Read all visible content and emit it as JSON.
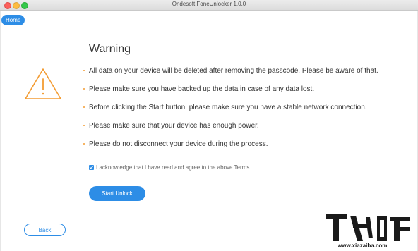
{
  "window": {
    "title": "Ondesoft FoneUnlocker 1.0.0"
  },
  "nav": {
    "home_label": "Home",
    "back_label": "Back"
  },
  "warning": {
    "title": "Warning",
    "items": [
      "All data on your device will be deleted after removing the passcode. Please be aware of that.",
      "Please make sure you have backed up the data in case of any data lost.",
      "Before clicking the Start button, please make sure you have a stable network connection.",
      "Please make sure that your device has enough power.",
      "Please do not disconnect your device during the process."
    ]
  },
  "acknowledge": {
    "checked": true,
    "label": "I acknowledge that I have read and agree to the above Terms."
  },
  "actions": {
    "start_label": "Start Unlock"
  },
  "watermark": {
    "brand": "下载吧",
    "url": "www.xiazaiba.com"
  },
  "colors": {
    "accent": "#2d8de6",
    "warning": "#f39c33"
  },
  "icons": {
    "warning": "warning-triangle-icon",
    "checkbox": "checkbox-checked-icon"
  }
}
